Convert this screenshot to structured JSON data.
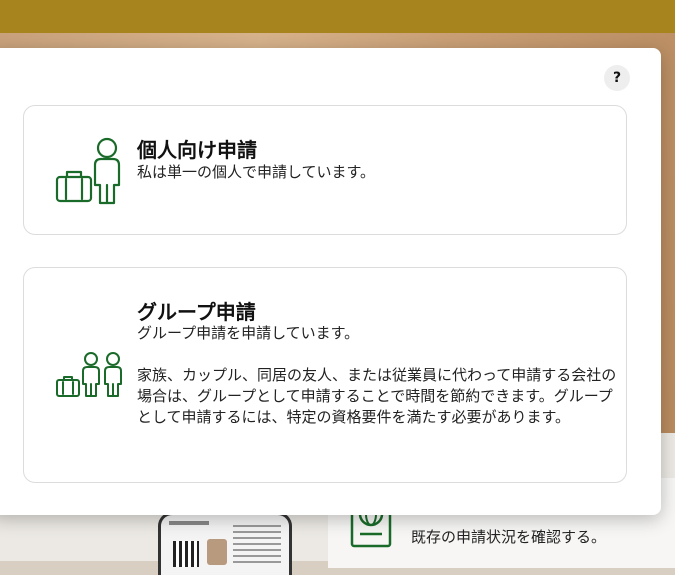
{
  "modal": {
    "help_label": "?",
    "options": [
      {
        "id": "individual",
        "icon": "traveler-with-suitcase-icon",
        "title": "個人向け申請",
        "description": "私は単一の個人で申請しています。"
      },
      {
        "id": "group",
        "icon": "group-travelers-icon",
        "title": "グループ申請",
        "description": "グループ申請を申請しています。",
        "detail": "家族、カップル、同居の友人、または従業員に代わって申請する会社の場合は、グループとして申請することで時間を節約できます。グループとして申請するには、特定の資格要件を満たす必要があります。"
      }
    ]
  },
  "background": {
    "status_text": "既存の申請状況を確認する。",
    "status_icon": "globe-document-icon"
  },
  "colors": {
    "icon_green": "#1a6b2a",
    "top_bar": "#a8841f"
  }
}
